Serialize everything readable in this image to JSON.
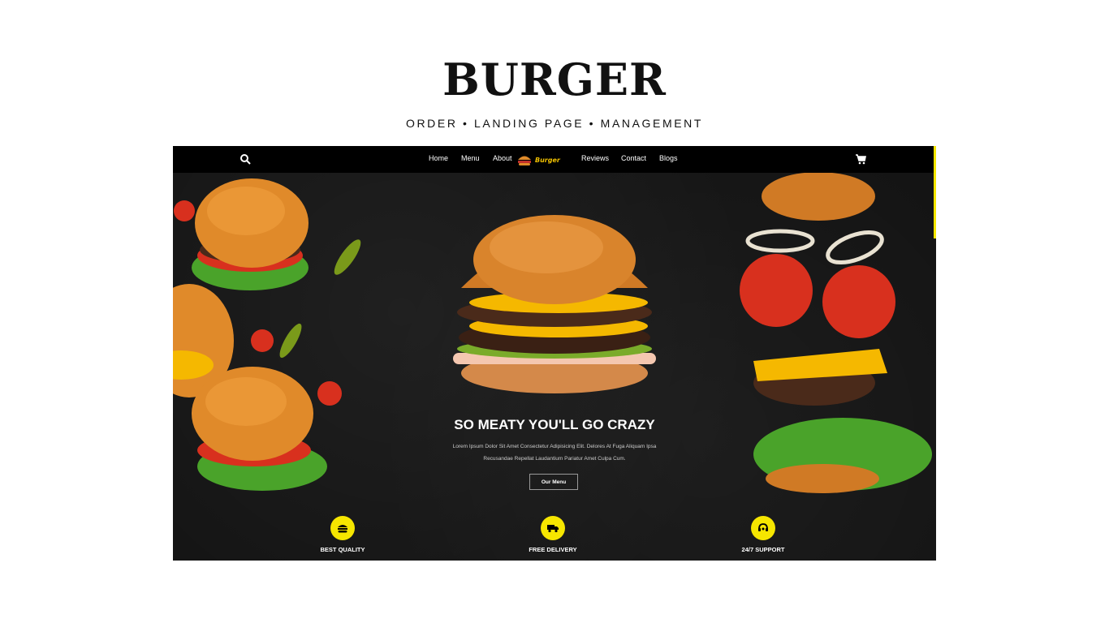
{
  "heading": {
    "title": "BURGER",
    "subtitle": "ORDER • LANDING PAGE • MANAGEMENT"
  },
  "nav": {
    "links": [
      "Home",
      "Menu",
      "About",
      "Reviews",
      "Contact",
      "Blogs"
    ],
    "logo_text": "Burger",
    "icons": [
      "search-icon",
      "cart-icon"
    ]
  },
  "hero": {
    "title": "SO MEATY YOU'LL GO CRAZY",
    "description_line1": "Lorem Ipsum Dolor Sit Amet Consectetur Adipisicing Elit. Delores At Fuga Aliquam Ipsa",
    "description_line2": "Recusandae Repellat Laudantium Pariatur Amet Culpa Cum.",
    "button": "Our Menu"
  },
  "features": [
    {
      "label": "BEST QUALITY",
      "icon": "burger-icon"
    },
    {
      "label": "FREE DELIVERY",
      "icon": "truck-icon"
    },
    {
      "label": "24/7 SUPPORT",
      "icon": "headset-icon"
    }
  ],
  "colors": {
    "accent": "#f6e600",
    "background": "#141414",
    "nav": "#000000",
    "bun": "#e08a2a",
    "patty": "#4a2a1a",
    "cheese": "#f5b800",
    "lettuce": "#4aa32a",
    "tomato": "#d8301e"
  }
}
